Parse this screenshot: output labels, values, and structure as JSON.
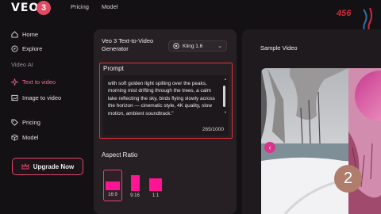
{
  "brand": {
    "logo_text": "VEO",
    "logo_number": "3"
  },
  "topnav": {
    "pricing": "Pricing",
    "model": "Model"
  },
  "sidebar": {
    "items": [
      {
        "label": "Home",
        "icon": "home-icon"
      },
      {
        "label": "Explore",
        "icon": "compass-icon"
      }
    ],
    "section_label": "Video AI",
    "ai_items": [
      {
        "label": "Text to video",
        "icon": "sparkle-icon",
        "active": true
      },
      {
        "label": "Image to video",
        "icon": "image-icon",
        "active": false
      }
    ],
    "bottom_items": [
      {
        "label": "Pricing",
        "icon": "tag-icon"
      },
      {
        "label": "Model",
        "icon": "cube-icon"
      }
    ],
    "upgrade_label": "Upgrade Now"
  },
  "generator": {
    "title": "Veo 3 Text-to-Video Generator",
    "model_value": "Kling 1.6",
    "prompt_label": "Prompt",
    "prompt_text": "with soft golden light spilling over the peaks, morning mist drifting through the trees, a calm lake reflecting the sky, birds flying slowly across the horizon — cinematic style, 4K quality, slow motion, ambient soundtrack.\"",
    "char_count": "265/1000",
    "aspect_label": "Aspect Ratio",
    "aspect_options": [
      {
        "label": "16:9",
        "selected": true
      },
      {
        "label": "9:16",
        "selected": false
      },
      {
        "label": "1:1",
        "selected": false
      }
    ]
  },
  "sample": {
    "title": "Sample Video",
    "slide_number": "2"
  },
  "watermark": {
    "text": "456"
  },
  "colors": {
    "accent": "#e2456a",
    "accent_active": "#f06a8a",
    "prompt_border": "#e0303c",
    "aspect_fill": "#ff1493",
    "background": "#141114",
    "panel": "#262024"
  }
}
